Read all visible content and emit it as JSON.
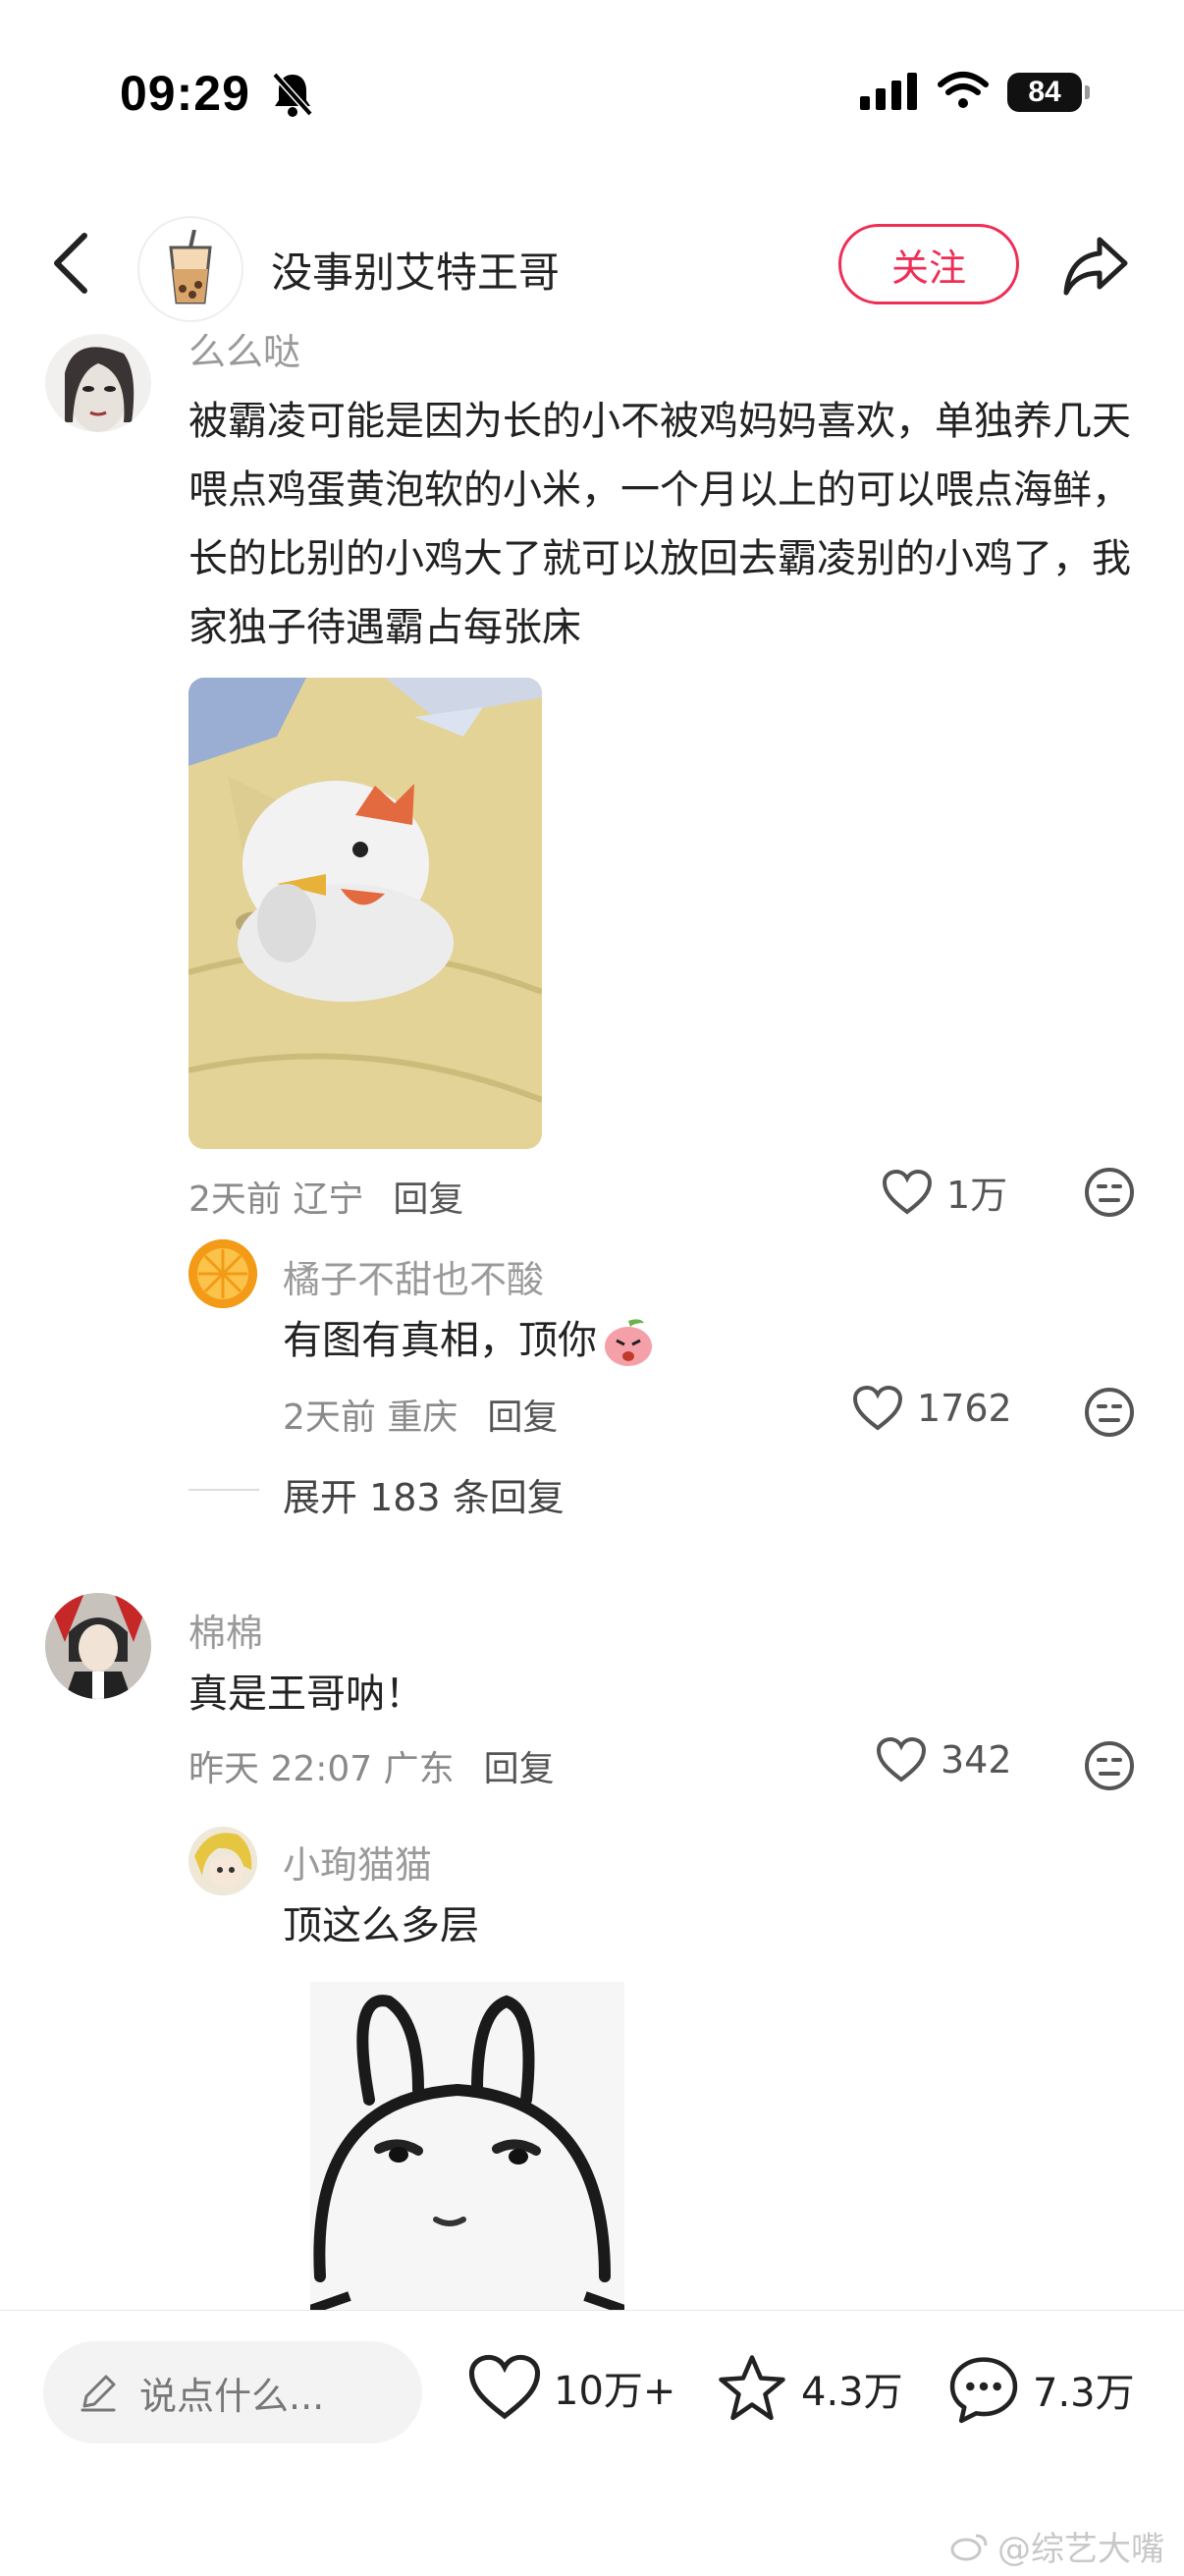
{
  "status_bar": {
    "time": "09:29",
    "battery": "84"
  },
  "header": {
    "title": "没事别艾特王哥",
    "follow_label": "关注"
  },
  "comments": [
    {
      "username": "么么哒",
      "text": "被霸凌可能是因为长的小不被鸡妈妈喜欢，单独养几天喂点鸡蛋黄泡软的小米，一个月以上的可以喂点海鲜，长的比别的小鸡大了就可以放回去霸凌别的小鸡了，我家独子待遇霸占每张床",
      "meta": "2天前 辽宁",
      "reply_label": "回复",
      "likes": "1万",
      "sub_reply": {
        "username": "橘子不甜也不酸",
        "text": "有图有真相，顶你",
        "meta": "2天前 重庆",
        "reply_label": "回复",
        "likes": "1762"
      },
      "expand_label": "展开 183 条回复"
    },
    {
      "username": "棉棉",
      "text": "真是王哥呐！",
      "meta": "昨天 22:07 广东",
      "reply_label": "回复",
      "likes": "342",
      "sub_reply": {
        "username": "小珣猫猫",
        "text": "顶这么多层"
      }
    }
  ],
  "bottom_bar": {
    "placeholder": "说点什么...",
    "likes": "10万+",
    "favorites": "4.3万",
    "comments": "7.3万"
  },
  "watermark": "@综艺大嘴",
  "colors": {
    "accent": "#ef2d55",
    "meta_text": "#8a8a8a"
  }
}
